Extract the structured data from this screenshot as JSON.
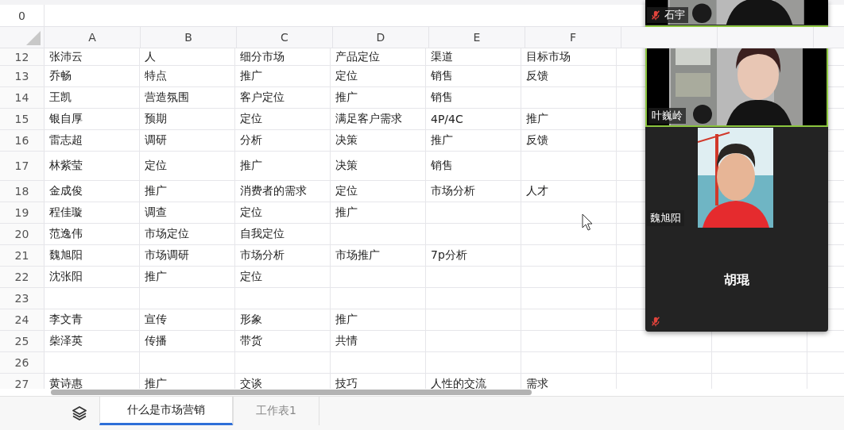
{
  "name_box": {
    "value": "0"
  },
  "columns": [
    "A",
    "B",
    "C",
    "D",
    "E",
    "F"
  ],
  "rows": [
    {
      "number": "12",
      "tall": false,
      "cells": [
        "张沛云",
        "人",
        "细分市场",
        "产品定位",
        "渠道",
        "目标市场"
      ]
    },
    {
      "number": "13",
      "tall": false,
      "cells": [
        "乔畅",
        "特点",
        "推广",
        "定位",
        "销售",
        "反馈"
      ]
    },
    {
      "number": "14",
      "tall": false,
      "cells": [
        "王凯",
        "营造氛围",
        "客户定位",
        "推广",
        "销售",
        null
      ]
    },
    {
      "number": "15",
      "tall": false,
      "cells": [
        "银自厚",
        "预期",
        "定位",
        "满足客户需求",
        "4P/4C",
        "推广"
      ]
    },
    {
      "number": "16",
      "tall": false,
      "cells": [
        "雷志超",
        "调研",
        "分析",
        "决策",
        "推广",
        "反馈"
      ]
    },
    {
      "number": "17",
      "tall": true,
      "cells": [
        "林紫莹",
        "定位",
        "推广",
        "决策",
        "销售",
        null
      ]
    },
    {
      "number": "18",
      "tall": false,
      "cells": [
        "金成俊",
        "推广",
        "消费者的需求",
        "定位",
        "市场分析",
        "人才"
      ]
    },
    {
      "number": "19",
      "tall": false,
      "cells": [
        "程佳璇",
        "调查",
        "定位",
        "推广",
        null,
        null
      ]
    },
    {
      "number": "20",
      "tall": false,
      "cells": [
        "范逸伟",
        "市场定位",
        "自我定位",
        null,
        null,
        null
      ]
    },
    {
      "number": "21",
      "tall": false,
      "cells": [
        "魏旭阳",
        "市场调研",
        "市场分析",
        "市场推广",
        "7p分析",
        null
      ]
    },
    {
      "number": "22",
      "tall": false,
      "cells": [
        "沈张阳",
        "推广",
        "定位",
        null,
        null,
        null
      ]
    },
    {
      "number": "23",
      "tall": false,
      "cells": [
        null,
        null,
        null,
        null,
        null,
        null
      ]
    },
    {
      "number": "24",
      "tall": false,
      "cells": [
        "李文青",
        "宣传",
        "形象",
        "推广",
        null,
        null
      ]
    },
    {
      "number": "25",
      "tall": false,
      "cells": [
        "柴泽英",
        "传播",
        "带货",
        "共情",
        null,
        null
      ]
    },
    {
      "number": "26",
      "tall": false,
      "cells": [
        null,
        null,
        null,
        null,
        null,
        null
      ]
    },
    {
      "number": "27",
      "tall": false,
      "cells": [
        "黄诗惠",
        "推广",
        "交谈",
        "技巧",
        "人性的交流",
        "需求"
      ]
    }
  ],
  "sheet_tabs": [
    {
      "label": "什么是市场营销",
      "selected": true
    },
    {
      "label": "工作表1",
      "selected": false
    }
  ],
  "participants": [
    {
      "name": "石宇",
      "kind": "video",
      "muted": true,
      "speaking": false
    },
    {
      "name": "叶巍岭",
      "kind": "video",
      "muted": false,
      "speaking": true
    },
    {
      "name": "魏旭阳",
      "kind": "portrait",
      "muted": false,
      "speaking": false
    },
    {
      "name": "胡琨",
      "kind": "noVideo",
      "muted": true,
      "speaking": false
    }
  ]
}
